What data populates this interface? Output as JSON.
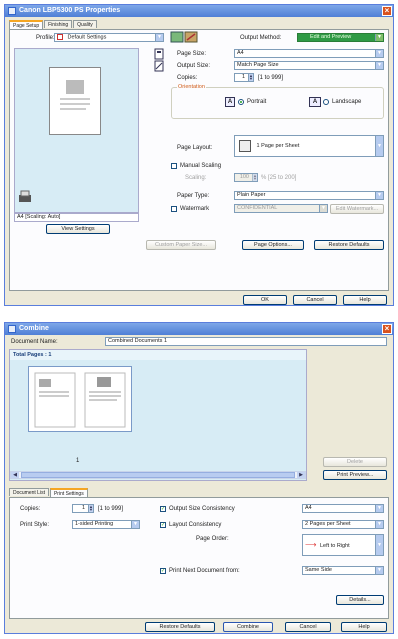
{
  "properties_dialog": {
    "title": "Canon LBP5300 PS Properties",
    "tabs": [
      {
        "label": "Page Setup",
        "active": true
      },
      {
        "label": "Finishing",
        "active": false
      },
      {
        "label": "Quality",
        "active": false
      }
    ],
    "profile_label": "Profile:",
    "profile_value": "Default Settings",
    "output_method_label": "Output Method:",
    "output_method_value": "Edit and Preview",
    "preview_caption": "A4 [Scaling: Auto]",
    "view_settings": "View Settings",
    "page_size_label": "Page Size:",
    "page_size_value": "A4",
    "output_size_label": "Output Size:",
    "output_size_value": "Match Page Size",
    "copies_label": "Copies:",
    "copies_value": "1",
    "copies_range": "[1 to 999]",
    "orientation_label": "Orientation",
    "portrait_label": "Portrait",
    "landscape_label": "Landscape",
    "orientation_icon_letter": "A",
    "page_layout_label": "Page Layout:",
    "page_layout_value": "1 Page per Sheet",
    "manual_scaling_label": "Manual Scaling",
    "scaling_label": "Scaling:",
    "scaling_value": "100",
    "scaling_range": "% [25 to 200]",
    "paper_type_label": "Paper Type:",
    "paper_type_value": "Plain Paper",
    "watermark_label": "Watermark",
    "watermark_value": "CONFIDENTIAL",
    "edit_watermark": "Edit Watermark...",
    "custom_paper_size": "Custom Paper Size...",
    "page_options": "Page Options...",
    "restore_defaults": "Restore Defaults",
    "ok": "OK",
    "cancel": "Cancel",
    "help": "Help"
  },
  "combine_dialog": {
    "title": "Combine",
    "document_name_label": "Document Name:",
    "document_name_value": "Combined Documents 1",
    "total_pages": "Total Pages : 1",
    "thumbnail_page_number": "1",
    "delete": "Delete",
    "print_preview": "Print Preview...",
    "tabs": [
      {
        "label": "Document List",
        "active": false
      },
      {
        "label": "Print Settings",
        "active": true
      }
    ],
    "copies_label": "Copies:",
    "copies_value": "1",
    "copies_range": "[1 to 999]",
    "print_style_label": "Print Style:",
    "print_style_value": "1-sided Printing",
    "output_size_consistency": "Output Size Consistency",
    "output_size_value": "A4",
    "layout_consistency": "Layout Consistency",
    "layout_value": "2 Pages per Sheet",
    "page_order_label": "Page Order:",
    "page_order_value": "Left to Right",
    "print_next_doc": "Print Next Document from:",
    "print_next_value": "Same Side",
    "details": "Details...",
    "restore_defaults": "Restore Defaults",
    "combine": "Combine",
    "cancel": "Cancel",
    "help": "Help"
  },
  "colors": {
    "titlebar": "#4f7fd6",
    "dialog_bg": "#ece9d8",
    "preview_bg": "#d7ecf5",
    "orientation_group_label": "#d05e1c",
    "checkbox_check": "#21a121"
  }
}
